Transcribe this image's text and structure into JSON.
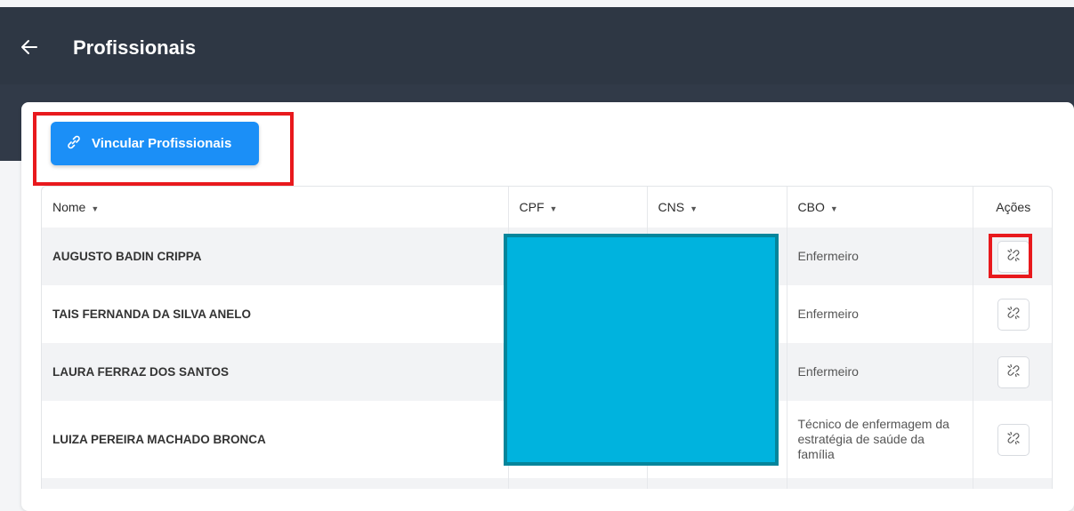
{
  "header": {
    "title": "Profissionais",
    "back_icon": "arrow-left-icon"
  },
  "toolbar": {
    "link_button_label": "Vincular Profissionais",
    "link_icon": "link-icon"
  },
  "table": {
    "columns": [
      "Nome",
      "CPF",
      "CNS",
      "CBO",
      "Ações"
    ],
    "rows": [
      {
        "nome": "AUGUSTO BADIN CRIPPA",
        "cbo": "Enfermeiro"
      },
      {
        "nome": "TAIS FERNANDA DA SILVA ANELO",
        "cbo": "Enfermeiro"
      },
      {
        "nome": "LAURA FERRAZ DOS SANTOS",
        "cbo": "Enfermeiro"
      },
      {
        "nome": "LUIZA PEREIRA MACHADO BRONCA",
        "cbo": "Técnico de enfermagem da estratégia de saúde da família"
      }
    ]
  },
  "colors": {
    "header_bg": "#2e3744",
    "primary": "#1b8ff7",
    "highlight": "#e8191d",
    "redaction": "#00b3de"
  }
}
